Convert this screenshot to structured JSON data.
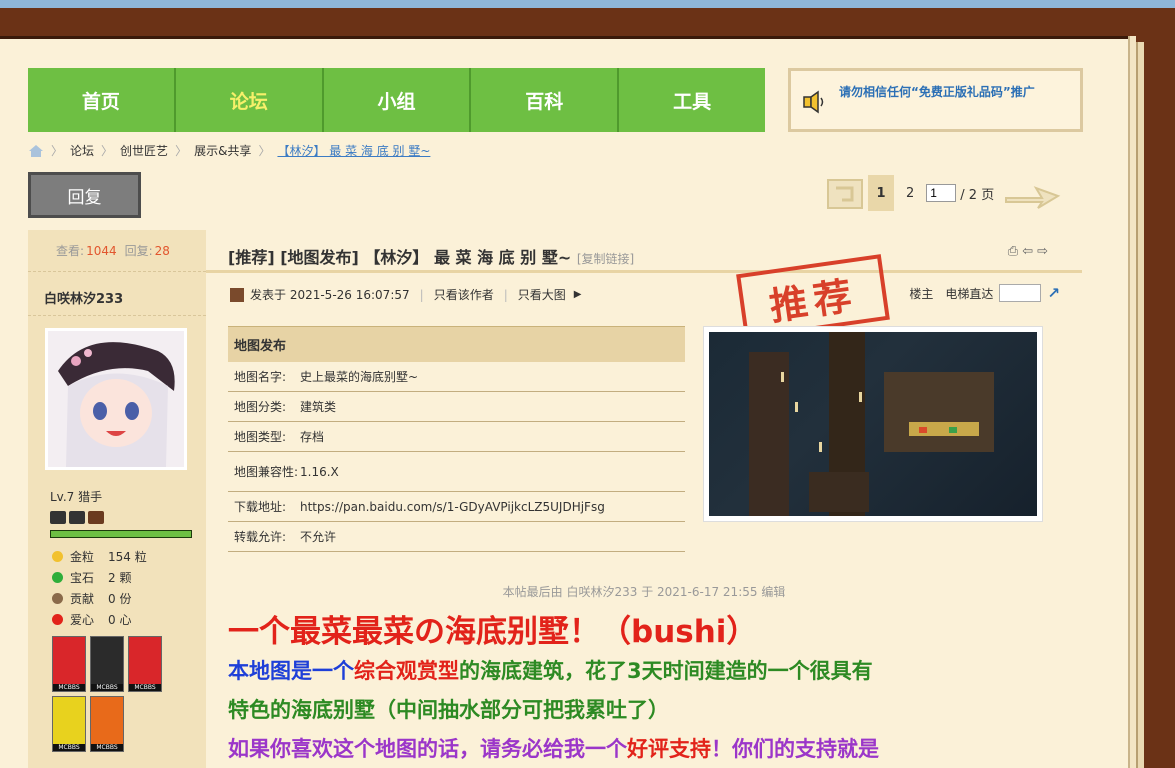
{
  "nav": {
    "items": [
      "首页",
      "论坛",
      "小组",
      "百科",
      "工具"
    ],
    "active_index": 1
  },
  "notice": {
    "text": "请勿相信任何“免费正版礼品码”推广"
  },
  "breadcrumb": [
    "论坛",
    "创世匠艺",
    "展示&共享",
    "【林汐】 最 菜 海 底 别 墅~"
  ],
  "reply_button": "回复",
  "pager": {
    "current": "1",
    "next": "2",
    "input_value": "1",
    "total": "/ 2 页"
  },
  "sidebar": {
    "views_label": "查看:",
    "views": "1044",
    "replies_label": "回复:",
    "replies": "28",
    "username": "白咲林汐233",
    "level": "Lv.7 猎手",
    "xp_fraction": 1.0,
    "credits": [
      {
        "label": "金粒",
        "value": "154 粒",
        "color": "#f2c12e"
      },
      {
        "label": "宝石",
        "value": "2 颗",
        "color": "#2fae3a"
      },
      {
        "label": "贡献",
        "value": "0 份",
        "color": "#8a6a4a"
      },
      {
        "label": "爱心",
        "value": "0 心",
        "color": "#e2231a"
      }
    ],
    "medal_label": "MCBBS"
  },
  "post": {
    "title": "[推荐] [地图发布] 【林汐】 最 菜 海 底 别 墅~",
    "copy_link": "[复制链接]",
    "meta_posted": "发表于 2021-5-26 16:07:57",
    "meta_author_only": "只看该作者",
    "meta_big_image": "只看大图",
    "floor_label": "楼主",
    "jump_label": "电梯直达",
    "stamp": "推荐",
    "table": {
      "header": "地图发布",
      "rows": [
        {
          "label": "地图名字:",
          "value": "史上最菜的海底别墅~"
        },
        {
          "label": "地图分类:",
          "value": "建筑类"
        },
        {
          "label": "地图类型:",
          "value": "存档"
        },
        {
          "label": "地图兼容性:",
          "value": "1.16.X"
        },
        {
          "label": "下载地址:",
          "value": "https://pan.baidu.com/s/1-GDyAVPijkcLZ5UJDHjFsg"
        },
        {
          "label": "转载允许:",
          "value": "不允许"
        }
      ]
    },
    "edited": "本帖最后由 白咲林汐233 于 2021-6-17 21:55 编辑",
    "big_title": "一个最菜最菜の海底别墅！（bushi）",
    "line1_a": "本地图是一个",
    "line1_b": "综合观赏型",
    "line1_c": "的海底建筑，花了3天时间建造的一个很具有",
    "line2": "特色的海底别墅（中间抽水部分可把我累吐了）",
    "line3_a": "如果你喜欢这个地图的话，请务必给我一个",
    "line3_b": "好评支持",
    "line3_c": "！你们的支持就是"
  },
  "colors": {
    "nav_green": "#6ebf43",
    "active_nav": "#f7f06a",
    "link_blue": "#3b7bc4",
    "stat_red": "#e2562e"
  }
}
